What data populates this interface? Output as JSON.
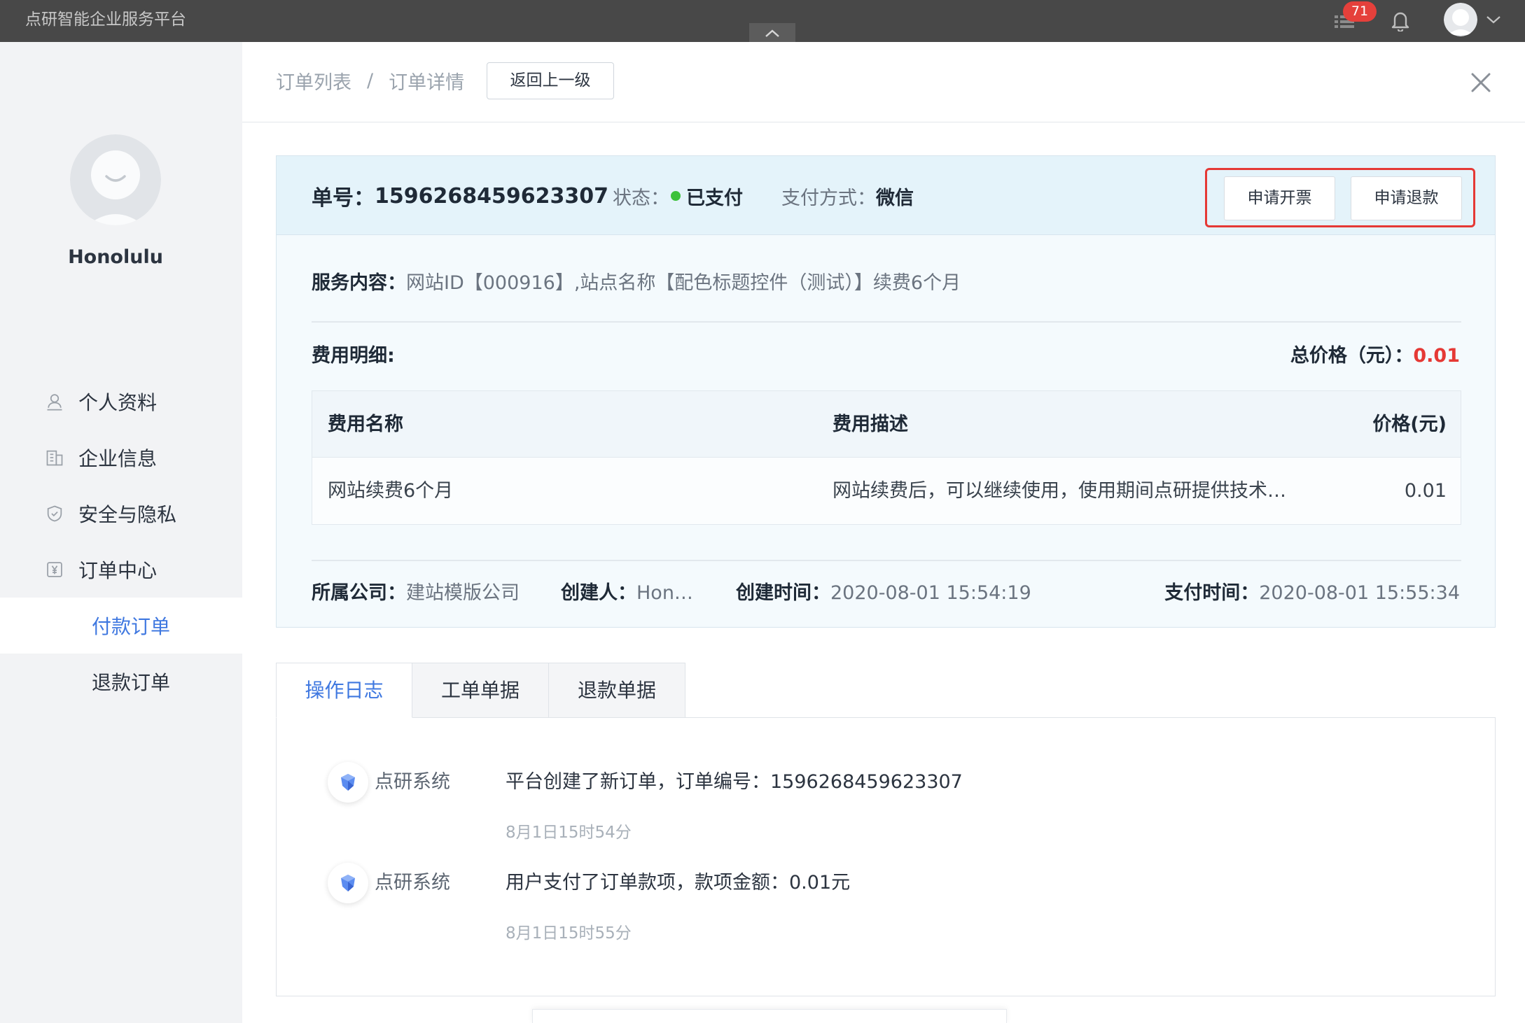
{
  "app": {
    "title": "点研智能企业服务平台",
    "notification_count": "71"
  },
  "user": {
    "name": "Honolulu"
  },
  "sidebar": {
    "items": [
      {
        "label": "个人资料",
        "icon": "user-icon"
      },
      {
        "label": "企业信息",
        "icon": "building-icon"
      },
      {
        "label": "安全与隐私",
        "icon": "shield-icon"
      },
      {
        "label": "订单中心",
        "icon": "yen-icon"
      },
      {
        "label": "付款订单",
        "active": true
      },
      {
        "label": "退款订单"
      }
    ]
  },
  "breadcrumb": {
    "items": [
      "订单列表",
      "订单详情"
    ],
    "separator": "/",
    "back_button": "返回上一级"
  },
  "order": {
    "number_label": "单号：",
    "number": "1596268459623307",
    "status_label": "状态：",
    "status": "已支付",
    "status_color": "#3cc13b",
    "payment_label": "支付方式：",
    "payment": "微信",
    "actions": {
      "invoice": "申请开票",
      "refund": "申请退款"
    },
    "service_label": "服务内容：",
    "service": "网站ID【000916】,站点名称【配色标题控件（测试）】续费6个月",
    "fee_label": "费用明细:",
    "total_label": "总价格（元）：",
    "total": "0.01",
    "total_color": "#e53935",
    "fee_table": {
      "headers": [
        "费用名称",
        "费用描述",
        "价格(元)"
      ],
      "rows": [
        [
          "网站续费6个月",
          "网站续费后，可以继续使用，使用期间点研提供技术…",
          "0.01"
        ]
      ]
    },
    "company_label": "所属公司：",
    "company": "建站模版公司",
    "creator_label": "创建人：",
    "creator": "Hon…",
    "created_label": "创建时间：",
    "created": "2020-08-01 15:54:19",
    "paid_label": "支付时间：",
    "paid": "2020-08-01 15:55:34"
  },
  "tabs": [
    {
      "label": "操作日志",
      "active": true
    },
    {
      "label": "工单单据"
    },
    {
      "label": "退款单据"
    }
  ],
  "logs": [
    {
      "source": "点研系统",
      "message": "平台创建了新订单，订单编号：1596268459623307",
      "time": "8月1日15时54分"
    },
    {
      "source": "点研系统",
      "message": "用户支付了订单款项，款项金额：0.01元",
      "time": "8月1日15时55分"
    }
  ],
  "theme": {
    "topbar": "#484848",
    "accent": "#3f78e0",
    "highlight_border": "#e53935"
  }
}
